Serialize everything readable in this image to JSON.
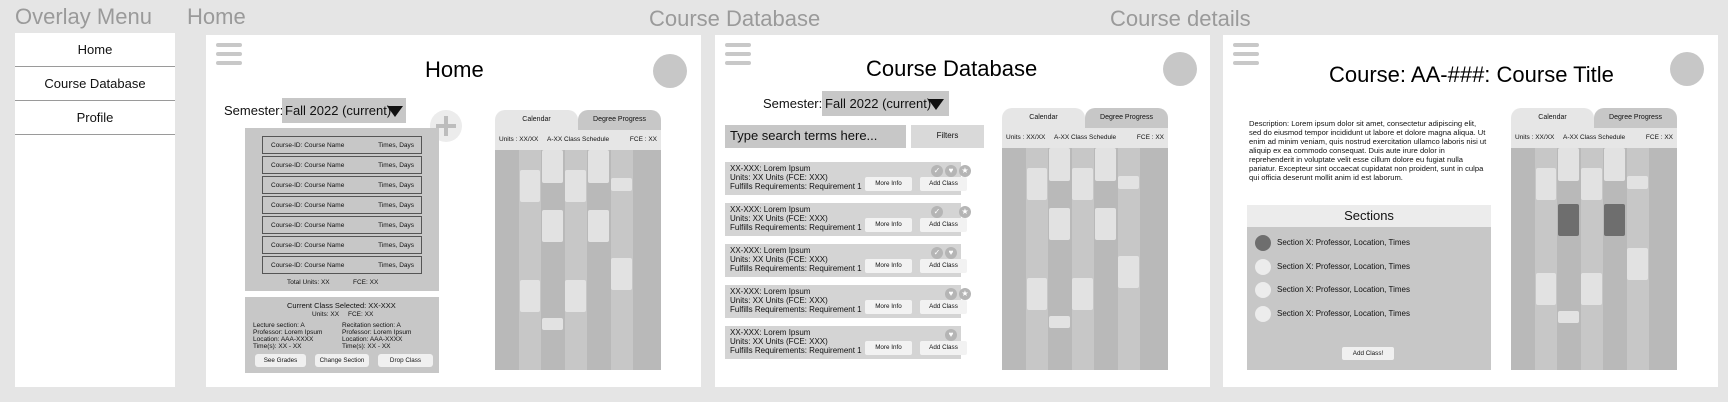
{
  "frames": {
    "overlay": {
      "title": "Overlay Menu",
      "items": [
        "Home",
        "Course Database",
        "Profile"
      ]
    },
    "home": {
      "frame_title": "Home",
      "page_title": "Home",
      "semester_label": "Semester:",
      "semester_value": "Fall 2022 (current)",
      "add_icon": "plus-icon",
      "schedule_rows": [
        {
          "name": "Course-ID: Course Name",
          "times": "Times, Days"
        },
        {
          "name": "Course-ID: Course Name",
          "times": "Times, Days"
        },
        {
          "name": "Course-ID: Course Name",
          "times": "Times, Days"
        },
        {
          "name": "Course-ID: Course Name",
          "times": "Times, Days"
        },
        {
          "name": "Course-ID: Course Name",
          "times": "Times, Days"
        },
        {
          "name": "Course-ID: Course Name",
          "times": "Times, Days"
        },
        {
          "name": "Course-ID: Course Name",
          "times": "Times, Days"
        }
      ],
      "total_units": "Total Units: XX",
      "total_fce": "FCE: XX",
      "selected": {
        "title": "Current Class Selected: XX-XXX",
        "units": "Units: XX",
        "fce": "FCE: XX",
        "left": [
          "Lecture section: A",
          "Professor: Lorem Ipsum",
          "Location: AAA-XXXX",
          "Time(s): XX - XX"
        ],
        "right": [
          "Recitation section: A",
          "Professor: Lorem Ipsum",
          "Location: AAA-XXXX",
          "Time(s): XX - XX"
        ],
        "buttons": [
          "See Grades",
          "Change Section",
          "Drop Class"
        ]
      }
    },
    "database": {
      "frame_title": "Course Database",
      "page_title": "Course Database",
      "semester_label": "Semester:",
      "semester_value": "Fall 2022 (current)",
      "search_placeholder": "Type search terms here...",
      "filters_label": "Filters",
      "courses": [
        {
          "code": "XX-XXX: Lorem Ipsum",
          "units": "Units: XX Units (FCE: XXX)",
          "req": "Fulfills Requirements: Requirement 1"
        },
        {
          "code": "XX-XXX: Lorem Ipsum",
          "units": "Units: XX Units (FCE: XXX)",
          "req": "Fulfills Requirements: Requirement 1"
        },
        {
          "code": "XX-XXX: Lorem Ipsum",
          "units": "Units: XX Units (FCE: XXX)",
          "req": "Fulfills Requirements: Requirement 1"
        },
        {
          "code": "XX-XXX: Lorem Ipsum",
          "units": "Units: XX Units (FCE: XXX)",
          "req": "Fulfills Requirements: Requirement 1"
        },
        {
          "code": "XX-XXX: Lorem Ipsum",
          "units": "Units: XX Units (FCE: XXX)",
          "req": "Fulfills Requirements: Requirement 1"
        }
      ],
      "more_info_label": "More Info",
      "add_class_label": "Add Class"
    },
    "details": {
      "frame_title": "Course details",
      "page_title": "Course: AA-###: Course Title",
      "description": "Description: Lorem ipsum dolor sit amet, consectetur adipiscing elit, sed do eiusmod tempor incididunt ut labore et dolore magna aliqua. Ut enim ad minim veniam, quis nostrud exercitation ullamco laboris nisi ut aliquip ex ea commodo consequat. Duis aute irure dolor in reprehenderit in voluptate velit esse cillum dolore eu fugiat nulla pariatur. Excepteur sint occaecat cupidatat non proident, sunt in culpa qui officia deserunt mollit anim id est laborum.",
      "sections_title": "Sections",
      "sections": [
        "Section X: Professor, Location, Times",
        "Section X: Professor, Location, Times",
        "Section X: Professor, Location, Times",
        "Section X: Professor, Location, Times"
      ],
      "add_class_label": "Add Class!"
    }
  },
  "calendar": {
    "tab_calendar": "Calendar",
    "tab_progress": "Degree Progress",
    "units": "Units : XX/XX",
    "schedule_label": "A-XX Class Schedule",
    "fce": "FCE : XX"
  },
  "colors": {
    "background": "#e5e5e5",
    "panel": "#c7c7c7",
    "selected_section": "#6e6e6e"
  }
}
